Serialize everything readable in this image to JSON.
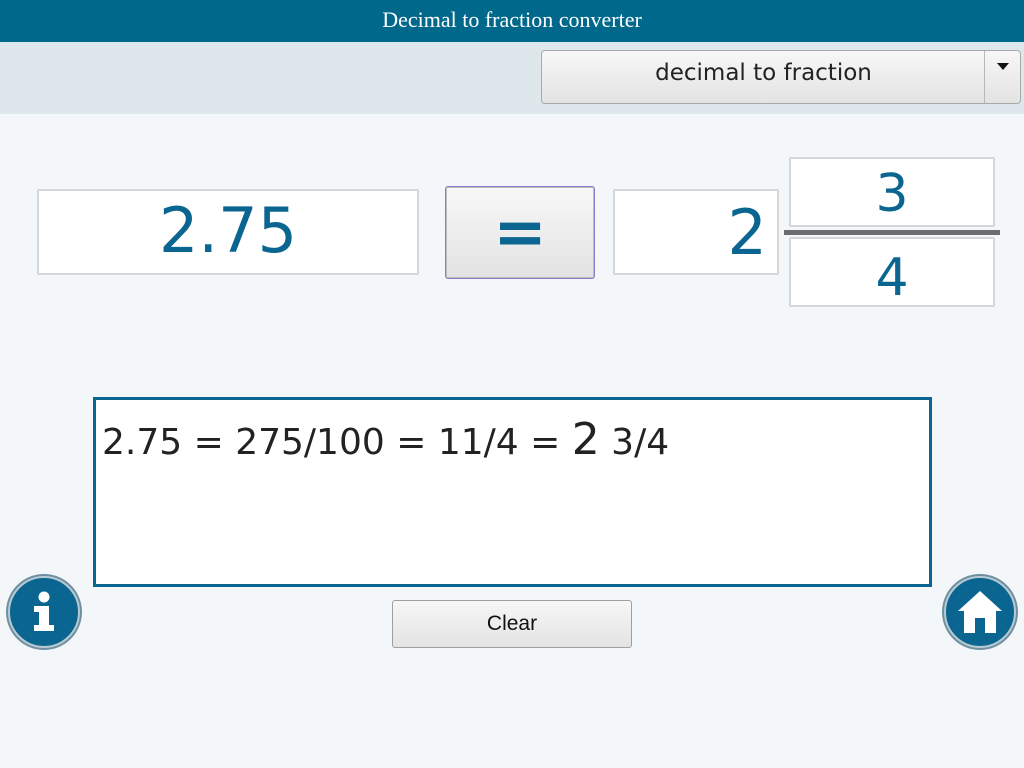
{
  "app": {
    "title": "Decimal to fraction converter"
  },
  "mode": {
    "selected": "decimal to fraction"
  },
  "input": {
    "decimal": "2.75"
  },
  "equals": {
    "label": "="
  },
  "output": {
    "whole": "2",
    "numerator": "3",
    "denominator": "4"
  },
  "steps": {
    "part1": "2.75 = 275/100 = 11/4 = ",
    "whole": "2",
    "part2": " 3/4"
  },
  "buttons": {
    "clear_label": "Clear"
  },
  "icons": {
    "info": "info-icon",
    "home": "home-icon"
  },
  "colors": {
    "accent": "#0a6690",
    "titlebar": "#00688b"
  }
}
